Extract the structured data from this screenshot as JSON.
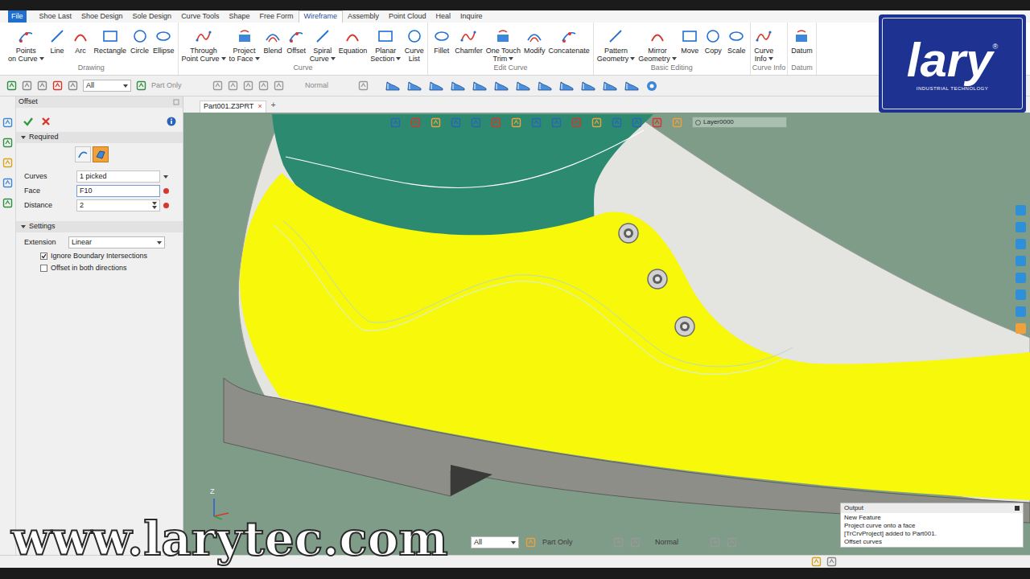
{
  "app_button": "File",
  "menu_tabs": [
    {
      "label": "Shoe Last",
      "selected": false
    },
    {
      "label": "Shoe Design",
      "selected": false
    },
    {
      "label": "Sole Design",
      "selected": false
    },
    {
      "label": "Curve Tools",
      "selected": false
    },
    {
      "label": "Shape",
      "selected": false
    },
    {
      "label": "Free Form",
      "selected": false
    },
    {
      "label": "Wireframe",
      "selected": true
    },
    {
      "label": "Assembly",
      "selected": false
    },
    {
      "label": "Point Cloud",
      "selected": false
    },
    {
      "label": "Heal",
      "selected": false
    },
    {
      "label": "Inquire",
      "selected": false
    }
  ],
  "ribbon_groups": [
    {
      "label": "Drawing",
      "tools": [
        {
          "label": "Points",
          "sub": "on Curve",
          "dropdown": true
        },
        {
          "label": "Line",
          "sub": "",
          "dropdown": false
        },
        {
          "label": "Arc",
          "sub": "",
          "dropdown": false
        },
        {
          "label": "Rectangle",
          "sub": "",
          "dropdown": false
        },
        {
          "label": "Circle",
          "sub": "",
          "dropdown": false
        },
        {
          "label": "Ellipse",
          "sub": "",
          "dropdown": false
        }
      ]
    },
    {
      "label": "Curve",
      "tools": [
        {
          "label": "Through",
          "sub": "Point Curve",
          "dropdown": true
        },
        {
          "label": "Project",
          "sub": "to Face",
          "dropdown": true
        },
        {
          "label": "Blend",
          "sub": "",
          "dropdown": false
        },
        {
          "label": "Offset",
          "sub": "",
          "dropdown": false
        },
        {
          "label": "Spiral",
          "sub": "Curve",
          "dropdown": true
        },
        {
          "label": "Equation",
          "sub": "",
          "dropdown": false
        },
        {
          "label": "Planar",
          "sub": "Section",
          "dropdown": true
        },
        {
          "label": "Curve",
          "sub": "List",
          "dropdown": false
        }
      ]
    },
    {
      "label": "Edit Curve",
      "tools": [
        {
          "label": "Fillet",
          "sub": "",
          "dropdown": false
        },
        {
          "label": "Chamfer",
          "sub": "",
          "dropdown": false
        },
        {
          "label": "One Touch",
          "sub": "Trim",
          "dropdown": true
        },
        {
          "label": "Modify",
          "sub": "",
          "dropdown": false
        },
        {
          "label": "Concatenate",
          "sub": "",
          "dropdown": false
        }
      ]
    },
    {
      "label": "Basic Editing",
      "tools": [
        {
          "label": "Pattern",
          "sub": "Geometry",
          "dropdown": true
        },
        {
          "label": "Mirror",
          "sub": "Geometry",
          "dropdown": true
        },
        {
          "label": "Move",
          "sub": "",
          "dropdown": false
        },
        {
          "label": "Copy",
          "sub": "",
          "dropdown": false
        },
        {
          "label": "Scale",
          "sub": "",
          "dropdown": false
        }
      ]
    },
    {
      "label": "Curve Info",
      "tools": [
        {
          "label": "Curve",
          "sub": "Info",
          "dropdown": true
        }
      ]
    },
    {
      "label": "Datum",
      "tools": [
        {
          "label": "Datum",
          "sub": "",
          "dropdown": false
        }
      ]
    }
  ],
  "logo": {
    "text": "lary",
    "mark": "®",
    "tagline": "INDUSTRIAL TECHNOLOGY"
  },
  "toolbar": {
    "filter": "All",
    "scope": "Part Only",
    "mode": "Normal"
  },
  "panel": {
    "title": "Offset",
    "required_label": "Required",
    "pick_modes": [
      {
        "selected": false
      },
      {
        "selected": true
      }
    ],
    "fields": [
      {
        "label": "Curves",
        "value": "1 picked",
        "kind": "select"
      },
      {
        "label": "Face",
        "value": "F10",
        "kind": "active"
      },
      {
        "label": "Distance",
        "value": "2",
        "kind": "spin"
      }
    ],
    "settings_label": "Settings",
    "extension": {
      "label": "Extension",
      "value": "Linear"
    },
    "options": [
      {
        "label": "Ignore Boundary Intersections",
        "checked": true
      },
      {
        "label": "Offset in both directions",
        "checked": false
      }
    ]
  },
  "document_tab": {
    "title": "Part001.Z3PRT",
    "close": "×",
    "add": "+"
  },
  "viewport": {
    "layer": "Layer0000",
    "axis_label": "Z"
  },
  "bottom_toolbar": {
    "filter": "All",
    "scope": "Part Only",
    "mode": "Normal"
  },
  "output": {
    "title": "Output",
    "lines": [
      "New Feature",
      "Project curve onto a face",
      "[TrCrvProject] added to Part001.",
      "Offset curves"
    ]
  },
  "watermark": "www.larytec.com"
}
